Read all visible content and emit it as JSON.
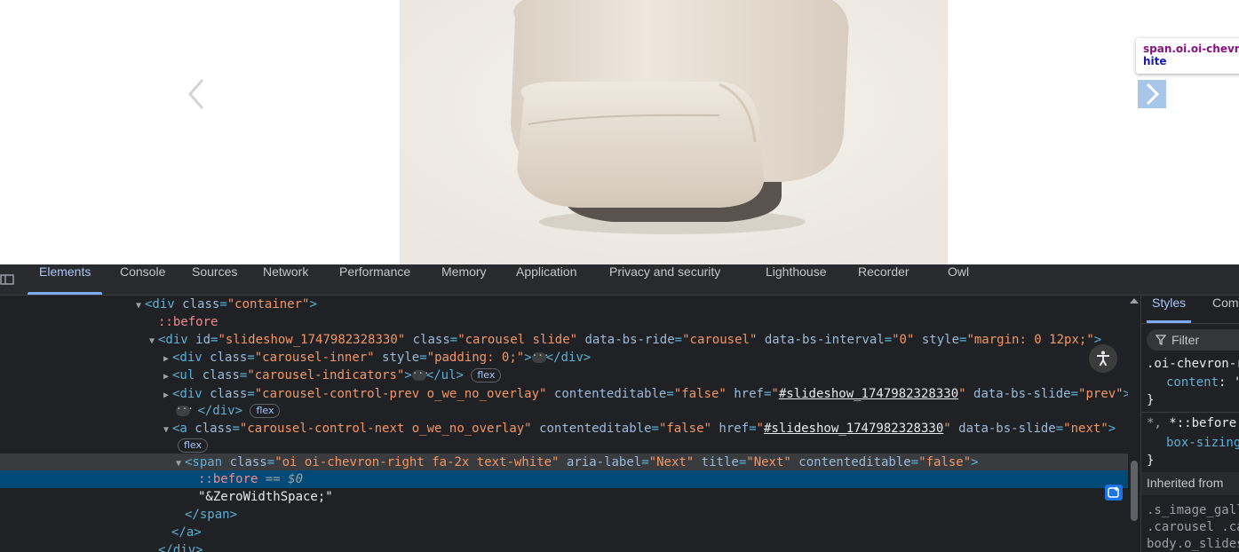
{
  "page": {
    "tooltip_line1": "span.oi.oi-chevron",
    "tooltip_line2": "hite",
    "prev_icon": "chevron-left-icon",
    "next_icon": "chevron-right-icon"
  },
  "devtools": {
    "tabs": [
      "Elements",
      "Console",
      "Sources",
      "Network",
      "Performance",
      "Memory",
      "Application",
      "Privacy and security",
      "Lighthouse",
      "Recorder",
      "Owl"
    ],
    "active_tab": "Elements",
    "dom": {
      "l1_tag": "<div",
      "l1_attr": "class",
      "l1_val": "\"container\"",
      "l1_end": ">",
      "l2_pseudo": "::before",
      "l3_tag": "<div",
      "l3_a1": "id",
      "l3_v1": "\"slideshow_1747982328330\"",
      "l3_a2": "class",
      "l3_v2": "\"carousel slide\"",
      "l3_a3": "data-bs-ride",
      "l3_v3": "\"carousel\"",
      "l3_a4": "data-bs-interval",
      "l3_v4": "\"0\"",
      "l3_a5": "style",
      "l3_v5": "\"margin: 0 12px;\"",
      "l3_end": ">",
      "l4_tag": "<div",
      "l4_a1": "class",
      "l4_v1": "\"carousel-inner\"",
      "l4_a2": "style",
      "l4_v2": "\"padding: 0;\"",
      "l4_mid": ">",
      "l4_close": "</div>",
      "l5_tag": "<ul",
      "l5_a1": "class",
      "l5_v1": "\"carousel-indicators\"",
      "l5_mid": ">",
      "l5_close": "</ul>",
      "l5_badge": "flex",
      "l6_tag": "<div",
      "l6_a1": "class",
      "l6_v1": "\"carousel-control-prev o_we_no_overlay\"",
      "l6_a2": "contenteditable",
      "l6_v2": "\"false\"",
      "l6_a3": "href",
      "l6_q1": "\"",
      "l6_link": "#slideshow_1747982328330",
      "l6_q2": "\"",
      "l6_a4": "data-bs-slide",
      "l6_v4": "\"prev\"",
      "l6_end": ">",
      "l7_close": "</div>",
      "l7_badge": "flex",
      "l8_tag": "<a",
      "l8_a1": "class",
      "l8_v1": "\"carousel-control-next o_we_no_overlay\"",
      "l8_a2": "contenteditable",
      "l8_v2": "\"false\"",
      "l8_a3": "href",
      "l8_q1": "\"",
      "l8_link": "#slideshow_1747982328330",
      "l8_q2": "\"",
      "l8_a4": "data-bs-slide",
      "l8_v4": "\"next\"",
      "l8_end": ">",
      "l9_badge": "flex",
      "l10_tag": "<span",
      "l10_a1": "class",
      "l10_v1": "\"oi oi-chevron-right fa-2x text-white\"",
      "l10_a2": "aria-label",
      "l10_v2": "\"Next\"",
      "l10_a3": "title",
      "l10_v3": "\"Next\"",
      "l10_a4": "contenteditable",
      "l10_v4": "\"false\"",
      "l10_end": ">",
      "l11_pseudo": "::before",
      "l11_eq": "== $0",
      "l12_text": "\"&ZeroWidthSpace;\"",
      "l13_close": "</span>",
      "l14_close": "</a>",
      "l15_close": "</div>"
    },
    "styles": {
      "tabs": [
        "Styles",
        "Com"
      ],
      "filter_placeholder": "Filter",
      "rule1_selector": ".oi-chevron-r",
      "rule1_prop": "content",
      "rule1_val": ": '",
      "rule1_close": "}",
      "rule2_selector_a": "*,",
      "rule2_selector_b": "*::before,",
      "rule2_prop": "box-sizing",
      "rule2_close": "}",
      "inherited_label": "Inherited from",
      "inh1": ".s_image_gall",
      "inh2": ".carousel .ca",
      "inh3": "body.o_slides"
    }
  }
}
